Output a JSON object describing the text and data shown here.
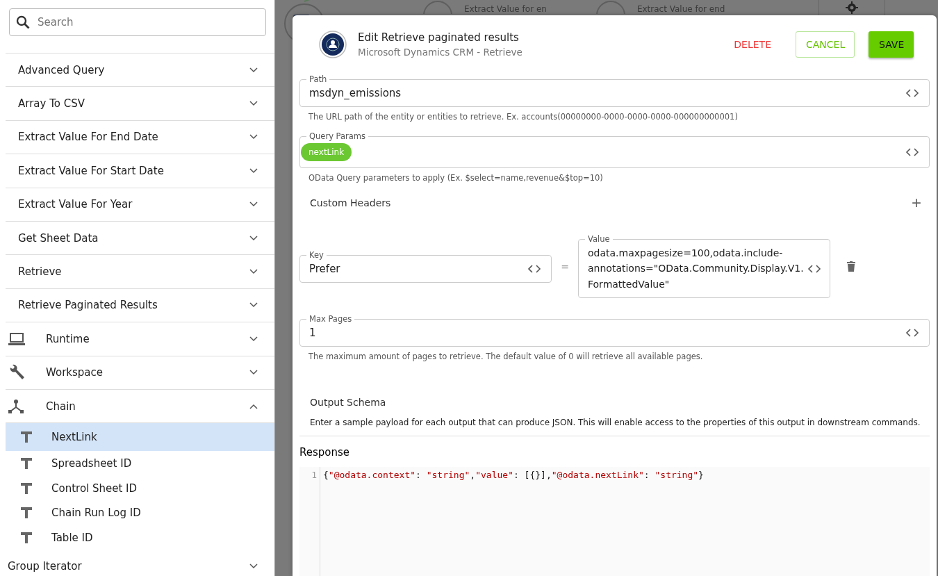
{
  "sidebar": {
    "search": {
      "placeholder": "Search"
    },
    "groups": [
      {
        "label": "Advanced Query",
        "kind": "plain",
        "expanded": false
      },
      {
        "label": "Array To CSV",
        "kind": "plain",
        "expanded": false
      },
      {
        "label": "Extract Value For End Date",
        "kind": "plain",
        "expanded": false
      },
      {
        "label": "Extract Value For Start Date",
        "kind": "plain",
        "expanded": false
      },
      {
        "label": "Extract Value For Year",
        "kind": "plain",
        "expanded": false
      },
      {
        "label": "Get Sheet Data",
        "kind": "plain",
        "expanded": false
      },
      {
        "label": "Retrieve",
        "kind": "plain",
        "expanded": false
      },
      {
        "label": "Retrieve Paginated Results",
        "kind": "plain",
        "expanded": false
      },
      {
        "label": "Runtime",
        "kind": "laptop",
        "expanded": false
      },
      {
        "label": "Workspace",
        "kind": "wrench",
        "expanded": false
      },
      {
        "label": "Chain",
        "kind": "chain",
        "expanded": true,
        "children": [
          {
            "label": "NextLink",
            "selected": true
          },
          {
            "label": "Spreadsheet ID",
            "selected": false
          },
          {
            "label": "Control Sheet ID",
            "selected": false
          },
          {
            "label": "Chain Run Log ID",
            "selected": false
          },
          {
            "label": "Table ID",
            "selected": false
          }
        ]
      },
      {
        "label": "Group Iterator",
        "kind": "root",
        "expanded": false
      }
    ]
  },
  "canvas": {
    "nodes": [
      {
        "label": "Extract Value for en"
      },
      {
        "label": "Extract Value for end"
      }
    ]
  },
  "dialog": {
    "title": "Edit Retrieve paginated results",
    "subtitle": "Microsoft Dynamics CRM - Retrieve",
    "buttons": [
      {
        "label": "DELETE",
        "kind": "danger"
      },
      {
        "label": "CANCEL",
        "kind": "outline"
      },
      {
        "label": "SAVE",
        "kind": "primary"
      }
    ],
    "path": {
      "label": "Path",
      "value": "msdyn_emissions",
      "help": "The URL path of the entity or entities to retrieve. Ex. accounts(00000000-0000-0000-0000-000000000001)"
    },
    "query_params": {
      "label": "Query Params",
      "chips": [
        "nextLink"
      ],
      "help": "OData Query parameters to apply (Ex. $select=name,revenue&$top=10)"
    },
    "custom_headers": {
      "title": "Custom Headers",
      "add": "+",
      "rows": [
        {
          "key_label": "Key",
          "key": "Prefer",
          "separator": "=",
          "value_label": "Value",
          "value": "odata.maxpagesize=100,odata.include-annotations=\"OData.Community.Display.V1.FormattedValue\""
        }
      ]
    },
    "max_pages": {
      "label": "Max Pages",
      "value": "1",
      "help": "The maximum amount of pages to retrieve. The default value of 0 will retrieve all available pages."
    },
    "output_schema": {
      "title": "Output Schema",
      "description": "Enter a sample payload for each output that can produce JSON. This will enable access to the properties of this output in downstream commands."
    },
    "response": {
      "title": "Response",
      "lines": [
        {
          "number": "1",
          "tokens": [
            {
              "text": "{",
              "kind": "punct"
            },
            {
              "text": "\"@odata.context\"",
              "kind": "string"
            },
            {
              "text": ": ",
              "kind": "punct"
            },
            {
              "text": "\"string\"",
              "kind": "string"
            },
            {
              "text": ",",
              "kind": "punct"
            },
            {
              "text": "\"value\"",
              "kind": "string"
            },
            {
              "text": ": [{}],",
              "kind": "punct"
            },
            {
              "text": "\"@odata.nextLink\"",
              "kind": "string"
            },
            {
              "text": ": ",
              "kind": "punct"
            },
            {
              "text": "\"string\"",
              "kind": "string"
            },
            {
              "text": "}",
              "kind": "punct"
            }
          ]
        }
      ]
    }
  }
}
